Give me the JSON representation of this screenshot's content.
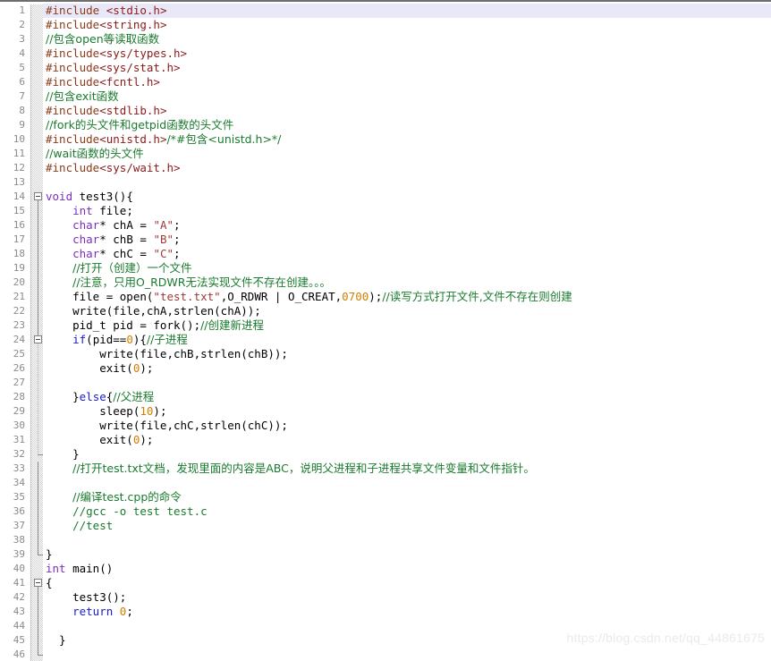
{
  "editor": {
    "language": "C",
    "current_line": 1,
    "first_line": 1,
    "last_line": 46,
    "watermark": "https://blog.csdn.net/qq_44861675",
    "colors": {
      "background": "#ffffff",
      "current_line_highlight": "#e8e8f8",
      "line_number": "#8a8a8a",
      "preprocessor": "#8b3a1a",
      "include_path": "#8b1a1a",
      "comment": "#1a7a2e",
      "keyword_type": "#7a2fbf",
      "keyword_control": "#1a1ad0",
      "number": "#d08000",
      "string": "#9b3a3a",
      "fold_margin": "#d2d2d2"
    }
  },
  "lines": [
    {
      "n": 1,
      "fold": "none",
      "tokens": [
        {
          "c": "t-pre",
          "t": "#include"
        },
        {
          "c": "t-plain",
          "t": " "
        },
        {
          "c": "t-inc",
          "t": "<stdio.h>"
        }
      ]
    },
    {
      "n": 2,
      "fold": "none",
      "tokens": [
        {
          "c": "t-pre",
          "t": "#include"
        },
        {
          "c": "t-inc",
          "t": "<string.h>"
        }
      ]
    },
    {
      "n": 3,
      "fold": "none",
      "tokens": [
        {
          "c": "t-cmt",
          "t": "//包含open等读取函数"
        }
      ]
    },
    {
      "n": 4,
      "fold": "none",
      "tokens": [
        {
          "c": "t-pre",
          "t": "#include"
        },
        {
          "c": "t-inc",
          "t": "<sys/types.h>"
        }
      ]
    },
    {
      "n": 5,
      "fold": "none",
      "tokens": [
        {
          "c": "t-pre",
          "t": "#include"
        },
        {
          "c": "t-inc",
          "t": "<sys/stat.h>"
        }
      ]
    },
    {
      "n": 6,
      "fold": "none",
      "tokens": [
        {
          "c": "t-pre",
          "t": "#include"
        },
        {
          "c": "t-inc",
          "t": "<fcntl.h>"
        }
      ]
    },
    {
      "n": 7,
      "fold": "none",
      "tokens": [
        {
          "c": "t-cmt",
          "t": "//包含exit函数"
        }
      ]
    },
    {
      "n": 8,
      "fold": "none",
      "tokens": [
        {
          "c": "t-pre",
          "t": "#include"
        },
        {
          "c": "t-inc",
          "t": "<stdlib.h>"
        }
      ]
    },
    {
      "n": 9,
      "fold": "none",
      "tokens": [
        {
          "c": "t-cmt",
          "t": "//fork的头文件和getpid函数的头文件"
        }
      ]
    },
    {
      "n": 10,
      "fold": "none",
      "tokens": [
        {
          "c": "t-pre",
          "t": "#include"
        },
        {
          "c": "t-inc",
          "t": "<unistd.h>"
        },
        {
          "c": "t-cmt",
          "t": "/*#包含<unistd.h>*/"
        }
      ]
    },
    {
      "n": 11,
      "fold": "none",
      "tokens": [
        {
          "c": "t-cmt",
          "t": "//wait函数的头文件"
        }
      ]
    },
    {
      "n": 12,
      "fold": "none",
      "tokens": [
        {
          "c": "t-pre",
          "t": "#include"
        },
        {
          "c": "t-inc",
          "t": "<sys/wait.h>"
        }
      ]
    },
    {
      "n": 13,
      "fold": "none",
      "tokens": []
    },
    {
      "n": 14,
      "fold": "box-solid",
      "tokens": [
        {
          "c": "t-kw",
          "t": "void"
        },
        {
          "c": "t-plain",
          "t": " test3(){"
        }
      ]
    },
    {
      "n": 15,
      "fold": "line-solid",
      "tokens": [
        {
          "c": "t-plain",
          "t": "    "
        },
        {
          "c": "t-kw",
          "t": "int"
        },
        {
          "c": "t-plain",
          "t": " file;"
        }
      ]
    },
    {
      "n": 16,
      "fold": "line-solid",
      "tokens": [
        {
          "c": "t-plain",
          "t": "    "
        },
        {
          "c": "t-kw",
          "t": "char"
        },
        {
          "c": "t-plain",
          "t": "* chA = "
        },
        {
          "c": "t-str",
          "t": "\"A\""
        },
        {
          "c": "t-plain",
          "t": ";"
        }
      ]
    },
    {
      "n": 17,
      "fold": "line-solid",
      "tokens": [
        {
          "c": "t-plain",
          "t": "    "
        },
        {
          "c": "t-kw",
          "t": "char"
        },
        {
          "c": "t-plain",
          "t": "* chB = "
        },
        {
          "c": "t-str",
          "t": "\"B\""
        },
        {
          "c": "t-plain",
          "t": ";"
        }
      ]
    },
    {
      "n": 18,
      "fold": "line-solid",
      "tokens": [
        {
          "c": "t-plain",
          "t": "    "
        },
        {
          "c": "t-kw",
          "t": "char"
        },
        {
          "c": "t-plain",
          "t": "* chC = "
        },
        {
          "c": "t-str",
          "t": "\"C\""
        },
        {
          "c": "t-plain",
          "t": ";"
        }
      ]
    },
    {
      "n": 19,
      "fold": "line-solid",
      "tokens": [
        {
          "c": "t-plain",
          "t": "    "
        },
        {
          "c": "t-cmt",
          "t": "//打开（创建）一个文件"
        }
      ]
    },
    {
      "n": 20,
      "fold": "line-solid",
      "tokens": [
        {
          "c": "t-plain",
          "t": "    "
        },
        {
          "c": "t-cmt",
          "t": "//注意，只用O_RDWR无法实现文件不存在创建。。。"
        }
      ]
    },
    {
      "n": 21,
      "fold": "line-solid",
      "tokens": [
        {
          "c": "t-plain",
          "t": "    file = open("
        },
        {
          "c": "t-str",
          "t": "\"test.txt\""
        },
        {
          "c": "t-plain",
          "t": ",O_RDWR | O_CREAT,"
        },
        {
          "c": "t-num",
          "t": "0700"
        },
        {
          "c": "t-plain",
          "t": ");"
        },
        {
          "c": "t-cmt",
          "t": "//读写方式打开文件,文件不存在则创建"
        }
      ]
    },
    {
      "n": 22,
      "fold": "line-solid",
      "tokens": [
        {
          "c": "t-plain",
          "t": "    write(file,chA,strlen(chA));"
        }
      ]
    },
    {
      "n": 23,
      "fold": "line-solid",
      "tokens": [
        {
          "c": "t-plain",
          "t": "    pid_t pid = fork();"
        },
        {
          "c": "t-cmt",
          "t": "//创建新进程"
        }
      ]
    },
    {
      "n": 24,
      "fold": "box-dotted",
      "tokens": [
        {
          "c": "t-plain",
          "t": "    "
        },
        {
          "c": "t-kwb",
          "t": "if"
        },
        {
          "c": "t-plain",
          "t": "(pid=="
        },
        {
          "c": "t-num",
          "t": "0"
        },
        {
          "c": "t-plain",
          "t": "){"
        },
        {
          "c": "t-cmt",
          "t": "//子进程"
        }
      ]
    },
    {
      "n": 25,
      "fold": "line-dotted",
      "tokens": [
        {
          "c": "t-plain",
          "t": "        write(file,chB,strlen(chB));"
        }
      ]
    },
    {
      "n": 26,
      "fold": "line-dotted",
      "tokens": [
        {
          "c": "t-plain",
          "t": "        exit("
        },
        {
          "c": "t-num",
          "t": "0"
        },
        {
          "c": "t-plain",
          "t": ");"
        }
      ]
    },
    {
      "n": 27,
      "fold": "line-dotted",
      "tokens": []
    },
    {
      "n": 28,
      "fold": "line-dotted",
      "tokens": [
        {
          "c": "t-plain",
          "t": "    }"
        },
        {
          "c": "t-kwb",
          "t": "else"
        },
        {
          "c": "t-plain",
          "t": "{"
        },
        {
          "c": "t-cmt",
          "t": "//父进程"
        }
      ]
    },
    {
      "n": 29,
      "fold": "line-dotted",
      "tokens": [
        {
          "c": "t-plain",
          "t": "        sleep("
        },
        {
          "c": "t-num",
          "t": "10"
        },
        {
          "c": "t-plain",
          "t": ");"
        }
      ]
    },
    {
      "n": 30,
      "fold": "line-dotted",
      "tokens": [
        {
          "c": "t-plain",
          "t": "        write(file,chC,strlen(chC));"
        }
      ]
    },
    {
      "n": 31,
      "fold": "line-dotted",
      "tokens": [
        {
          "c": "t-plain",
          "t": "        exit("
        },
        {
          "c": "t-num",
          "t": "0"
        },
        {
          "c": "t-plain",
          "t": ");"
        }
      ]
    },
    {
      "n": 32,
      "fold": "end-dotted",
      "tokens": [
        {
          "c": "t-plain",
          "t": "    }"
        }
      ]
    },
    {
      "n": 33,
      "fold": "line-solid",
      "tokens": [
        {
          "c": "t-plain",
          "t": "    "
        },
        {
          "c": "t-cmt",
          "t": "//打开test.txt文档，发现里面的内容是ABC，说明父进程和子进程共享文件变量和文件指针。"
        }
      ]
    },
    {
      "n": 34,
      "fold": "line-solid",
      "tokens": []
    },
    {
      "n": 35,
      "fold": "line-solid",
      "tokens": [
        {
          "c": "t-plain",
          "t": "    "
        },
        {
          "c": "t-cmt",
          "t": "//编译test.cpp的命令"
        }
      ]
    },
    {
      "n": 36,
      "fold": "line-solid",
      "tokens": [
        {
          "c": "t-plain",
          "t": "    "
        },
        {
          "c": "t-cmt",
          "t": "//gcc -o test test.c"
        }
      ]
    },
    {
      "n": 37,
      "fold": "line-solid",
      "tokens": [
        {
          "c": "t-plain",
          "t": "    "
        },
        {
          "c": "t-cmt",
          "t": "//test"
        }
      ]
    },
    {
      "n": 38,
      "fold": "line-solid",
      "tokens": []
    },
    {
      "n": 39,
      "fold": "end-solid",
      "tokens": [
        {
          "c": "t-plain",
          "t": "}"
        }
      ]
    },
    {
      "n": 40,
      "fold": "none",
      "tokens": [
        {
          "c": "t-kw",
          "t": "int"
        },
        {
          "c": "t-plain",
          "t": " main()"
        }
      ]
    },
    {
      "n": 41,
      "fold": "box-solid",
      "tokens": [
        {
          "c": "t-plain",
          "t": "{"
        }
      ]
    },
    {
      "n": 42,
      "fold": "line-solid",
      "tokens": [
        {
          "c": "t-plain",
          "t": "    test3();"
        }
      ]
    },
    {
      "n": 43,
      "fold": "line-solid",
      "tokens": [
        {
          "c": "t-plain",
          "t": "    "
        },
        {
          "c": "t-kwb",
          "t": "return"
        },
        {
          "c": "t-plain",
          "t": " "
        },
        {
          "c": "t-num",
          "t": "0"
        },
        {
          "c": "t-plain",
          "t": ";"
        }
      ]
    },
    {
      "n": 44,
      "fold": "line-solid",
      "tokens": []
    },
    {
      "n": 45,
      "fold": "line-solid",
      "tokens": [
        {
          "c": "t-plain",
          "t": "  }"
        }
      ]
    },
    {
      "n": 46,
      "fold": "end-solid",
      "tokens": []
    }
  ]
}
